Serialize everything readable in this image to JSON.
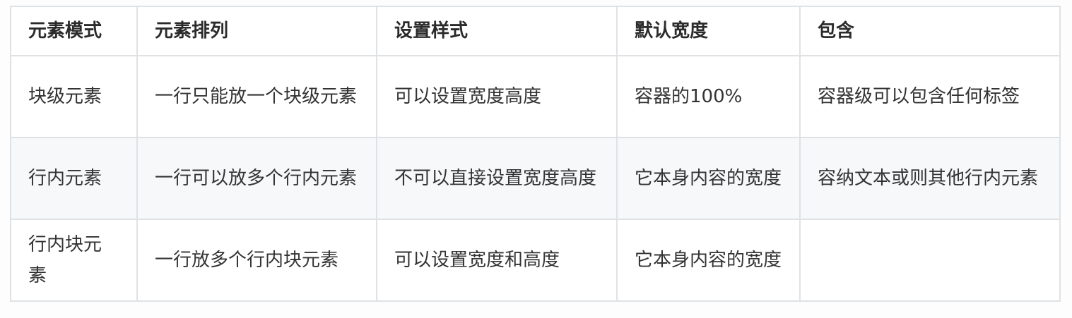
{
  "table": {
    "headers": [
      "元素模式",
      "元素排列",
      "设置样式",
      "默认宽度",
      "包含"
    ],
    "rows": [
      [
        "块级元素",
        "一行只能放一个块级元素",
        "可以设置宽度高度",
        "容器的100%",
        "容器级可以包含任何标签"
      ],
      [
        "行内元素",
        "一行可以放多个行内元素",
        "不可以直接设置宽度高度",
        "它本身内容的宽度",
        "容纳文本或则其他行内元素"
      ],
      [
        "行内块元素",
        "一行放多个行内块元素",
        "可以设置宽度和高度",
        "它本身内容的宽度",
        ""
      ]
    ]
  }
}
